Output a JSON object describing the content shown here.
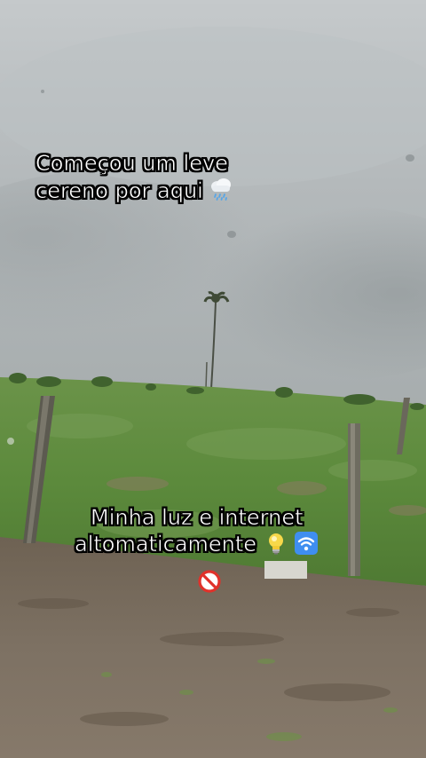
{
  "overlay": {
    "caption_top": {
      "line1": "Começou um leve",
      "line2": "cereno por aqui",
      "emoji": "cloud-with-rain"
    },
    "caption_bottom": {
      "line1": "Minha luz e internet",
      "line2": "altomaticamente",
      "emojis": [
        "light-bulb",
        "wifi-signal",
        "prohibited"
      ]
    }
  },
  "scene": {
    "description_colors": {
      "sky": "#b9bec0",
      "grass": "#5f8a3f",
      "dirt": "#7b6f5f"
    }
  }
}
